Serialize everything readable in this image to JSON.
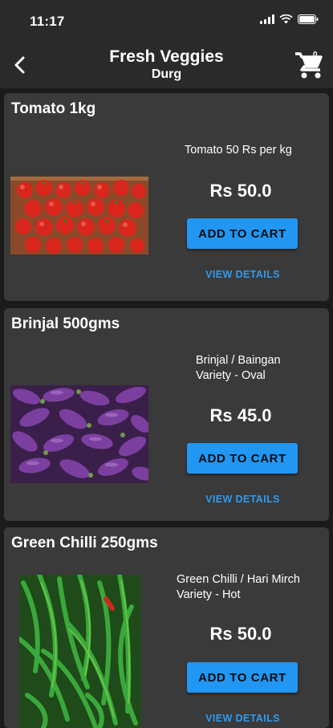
{
  "status_bar": {
    "time": "11:17"
  },
  "header": {
    "title": "Fresh Veggies",
    "subtitle": "Durg",
    "cart_count": "0"
  },
  "products": [
    {
      "title": "Tomato 1kg",
      "description": "Tomato 50 Rs per kg",
      "price": "Rs 50.0",
      "add_label": "ADD TO CART",
      "details_label": "VIEW DETAILS"
    },
    {
      "title": "Brinjal 500gms",
      "description_lines": [
        "Brinjal / Baingan",
        "Variety - Oval"
      ],
      "price": "Rs 45.0",
      "add_label": "ADD TO CART",
      "details_label": "VIEW DETAILS"
    },
    {
      "title": "Green Chilli 250gms",
      "description_lines": [
        "Green Chilli / Hari Mirch",
        "Variety - Hot"
      ],
      "price": "Rs 50.0",
      "add_label": "ADD TO CART",
      "details_label": "VIEW DETAILS"
    }
  ],
  "colors": {
    "accent": "#2196f3",
    "link": "#2f9bf0",
    "card": "#3a3a3a",
    "background": "#1b1b1b",
    "bar": "#2a2a2a"
  }
}
